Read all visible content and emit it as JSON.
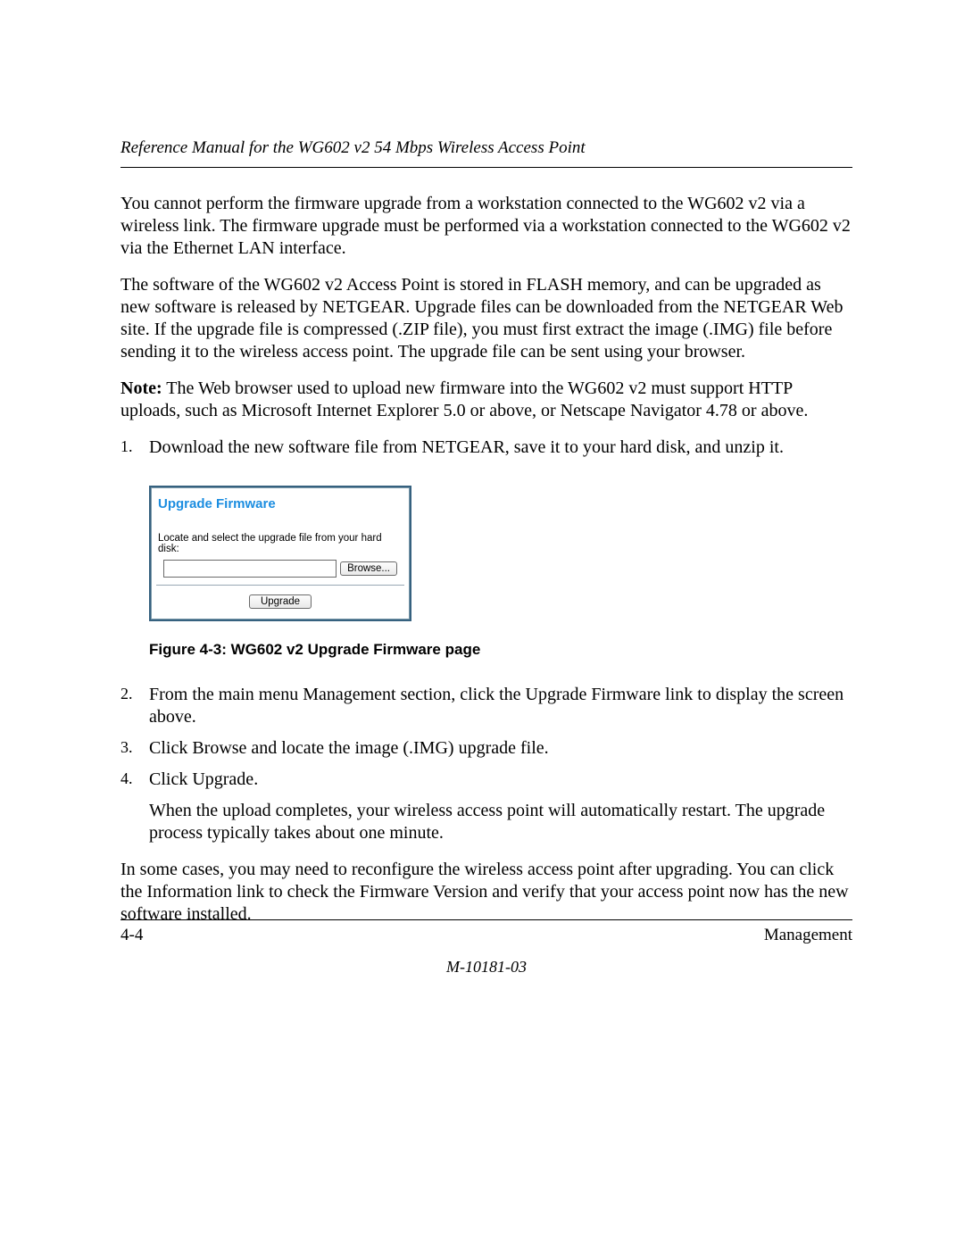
{
  "header": {
    "running_title": "Reference Manual for the WG602 v2 54 Mbps Wireless Access Point"
  },
  "paragraphs": {
    "p1": "You cannot perform the firmware upgrade from a workstation connected to the WG602 v2 via a wireless link. The firmware upgrade must be performed via a workstation connected to the WG602 v2 via the Ethernet LAN interface.",
    "p2": "The software of the WG602 v2 Access Point is stored in FLASH memory, and can be upgraded as new software is released by NETGEAR. Upgrade files can be downloaded from the NETGEAR Web site. If the upgrade file is compressed (.ZIP file), you must first extract the image (.IMG) file before sending it to the wireless access point. The upgrade file can be sent using your browser.",
    "note_label": "Note:",
    "p3": " The Web browser used to upload new firmware into the WG602 v2 must support HTTP uploads, such as Microsoft Internet Explorer 5.0 or above, or Netscape Navigator 4.78 or above.",
    "p_tail": "In some cases, you may need to reconfigure the wireless access point after upgrading. You can click the Information link to check the Firmware Version and verify that your access point now has the new software installed."
  },
  "steps1": {
    "s1": "Download the new software file from NETGEAR, save it to your hard disk, and unzip it."
  },
  "steps2": {
    "s2": "From the main menu Management section, click the Upgrade Firmware link to display the screen above.",
    "s3": "Click Browse and locate the image (.IMG) upgrade file.",
    "s4": "Click Upgrade.",
    "s4_note": "When the upload completes, your wireless access point will automatically restart. The upgrade process typically takes about one minute."
  },
  "figure": {
    "panel_title": "Upgrade Firmware",
    "panel_label": "Locate and select the upgrade file from your hard disk:",
    "file_value": "",
    "browse_label": "Browse...",
    "upgrade_label": "Upgrade",
    "caption": "Figure 4-3:  WG602 v2 Upgrade Firmware page"
  },
  "footer": {
    "page_num": "4-4",
    "section": "Management",
    "doc_id": "M-10181-03"
  }
}
